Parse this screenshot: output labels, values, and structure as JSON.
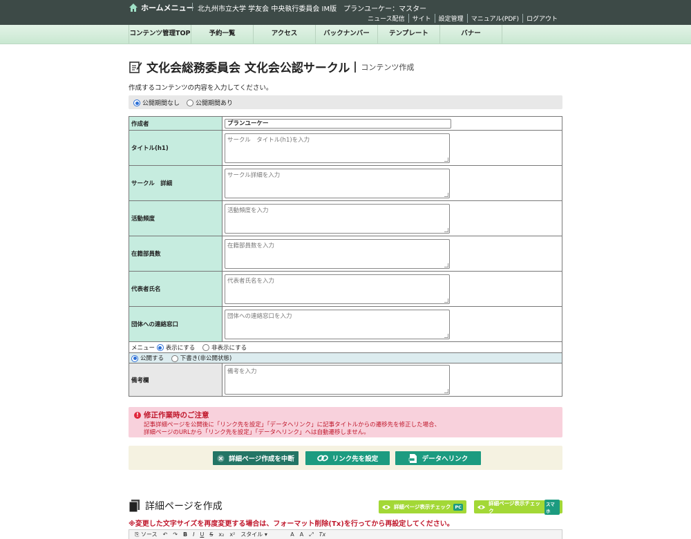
{
  "topbar": {
    "home_label": "ホームメニュー",
    "site_info": "北九州市立大学 学友会 中央執行委員会 IM版　プランユーケー：マスター",
    "links": [
      "ニュース配信",
      "サイト",
      "設定管理",
      "マニュアル(PDF)",
      "ログアウト"
    ]
  },
  "nav": [
    "コンテンツ管理TOP",
    "予約一覧",
    "アクセス",
    "バックナンバー",
    "テンプレート",
    "バナー"
  ],
  "page": {
    "title": "文化会総務委員会 文化会公認サークル",
    "subtitle": "コンテンツ作成",
    "description": "作成するコンテンツの内容を入力してください。"
  },
  "publish_period": {
    "opt1": "公開期間なし",
    "opt2": "公開期間あり"
  },
  "form": {
    "author_label": "作成者",
    "author_value": "プランユーケー",
    "fields": [
      {
        "label": "タイトル(h1)",
        "placeholder": "サークル　タイトル(h1)を入力"
      },
      {
        "label": "サークル　詳細",
        "placeholder": "サークル詳細を入力"
      },
      {
        "label": "活動頻度",
        "placeholder": "活動頻度を入力"
      },
      {
        "label": "在籍部員数",
        "placeholder": "在籍部員数を入力"
      },
      {
        "label": "代表者氏名",
        "placeholder": "代表者氏名を入力"
      },
      {
        "label": "団体への連絡窓口",
        "placeholder": "団体への連絡窓口を入力"
      }
    ],
    "menu_label": "メニュー",
    "menu_show": "表示にする",
    "menu_hide": "非表示にする",
    "publish": "公開する",
    "draft": "下書き(非公開状態)",
    "remarks_label": "備考欄",
    "remarks_placeholder": "備考を入力"
  },
  "notice": {
    "title": "修正作業時のご注意",
    "line1": "記事詳細ページを公開後に「リンク先を設定」「データへリンク」に記事タイトルからの遷移先を修正した場合、",
    "line2": "詳細ページのURLから「リンク先を設定」「データへリンク」へは自動遷移しません。"
  },
  "buttons": {
    "cancel": "詳細ページ作成を中断",
    "link": "リンク先を設定",
    "data": "データへリンク"
  },
  "detail": {
    "title": "詳細ページを作成",
    "check_pc": "詳細ページ表示チェック",
    "pc_tag": "PC",
    "check_sp": "詳細ページ表示チェック",
    "sp_tag": "スマホ",
    "warning": "※変更した文字サイズを再度変更する場合は、フォーマット削除(Tx)を行ってから再設定してください。"
  },
  "toolbar": {
    "source": "ソース",
    "style": "スタイル",
    "items": [
      "B",
      "I",
      "U",
      "S",
      "x₂",
      "x²",
      "A",
      "A",
      "Tx"
    ]
  },
  "colors": {
    "topbar": "#3d4a47",
    "label_bg": "#c6ecdf",
    "accent": "#1c9b80",
    "notice_bg": "#f8d1dc",
    "warning": "#c0182c"
  }
}
